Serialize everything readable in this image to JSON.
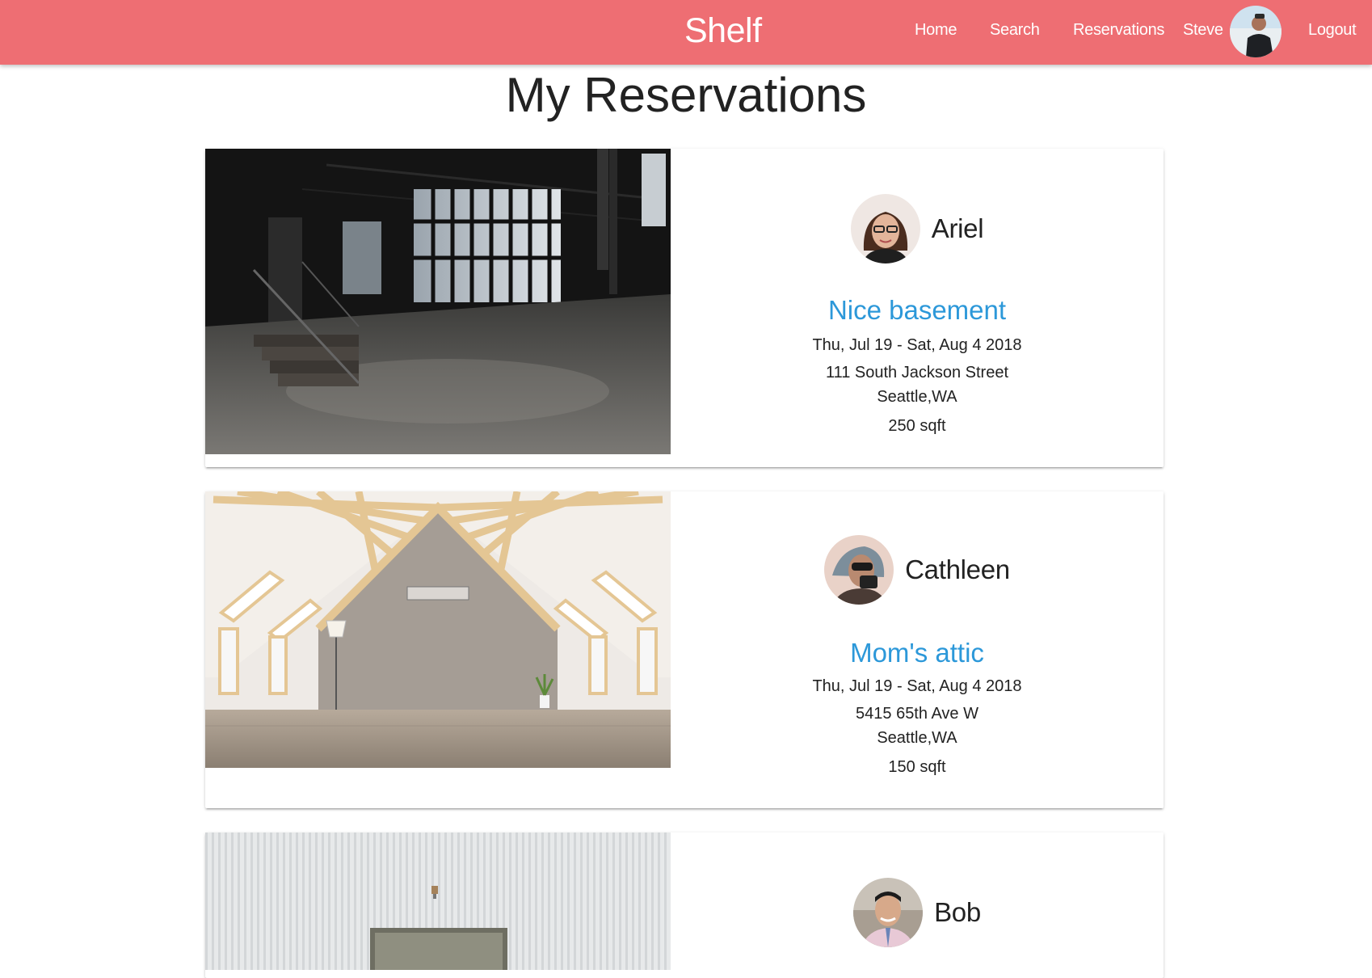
{
  "navbar": {
    "brand": "Shelf",
    "links": {
      "home": "Home",
      "search": "Search",
      "reservations": "Reservations"
    },
    "user_name": "Steve",
    "logout": "Logout",
    "color": "#ee6e73"
  },
  "page": {
    "title": "My Reservations"
  },
  "reservations": [
    {
      "host": "Ariel",
      "title": "Nice basement",
      "dates": "Thu, Jul 19 - Sat, Aug 4 2018",
      "street": "111 South Jackson Street",
      "city": "Seattle,WA",
      "size": "250 sqft"
    },
    {
      "host": "Cathleen",
      "title": "Mom's attic",
      "dates": "Thu, Jul 19 - Sat, Aug 4 2018",
      "street": "5415 65th Ave W",
      "city": "Seattle,WA",
      "size": "150 sqft"
    },
    {
      "host": "Bob"
    }
  ],
  "colors": {
    "link": "#2c98d9"
  }
}
